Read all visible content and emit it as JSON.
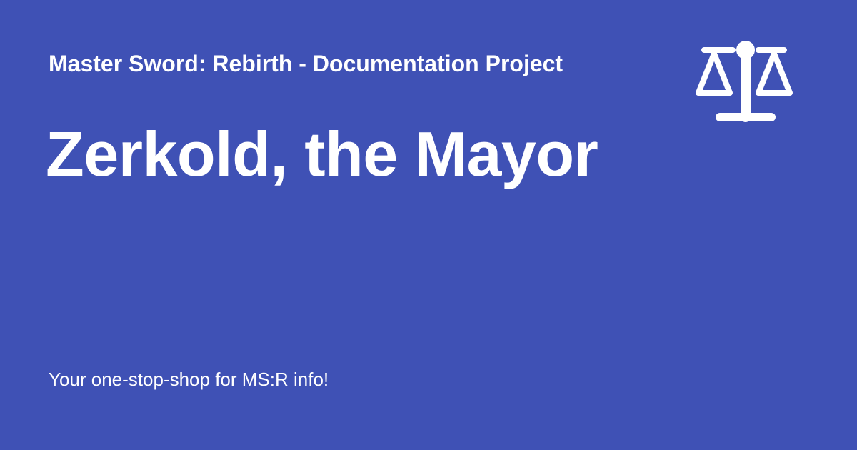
{
  "card": {
    "site_name": "Master Sword: Rebirth - Documentation Project",
    "page_title": "Zerkold, the Mayor",
    "tagline": "Your one-stop-shop for MS:R info!",
    "logo_icon": "scale-balance-icon"
  },
  "colors": {
    "background": "#3f51b5",
    "text": "#ffffff"
  }
}
